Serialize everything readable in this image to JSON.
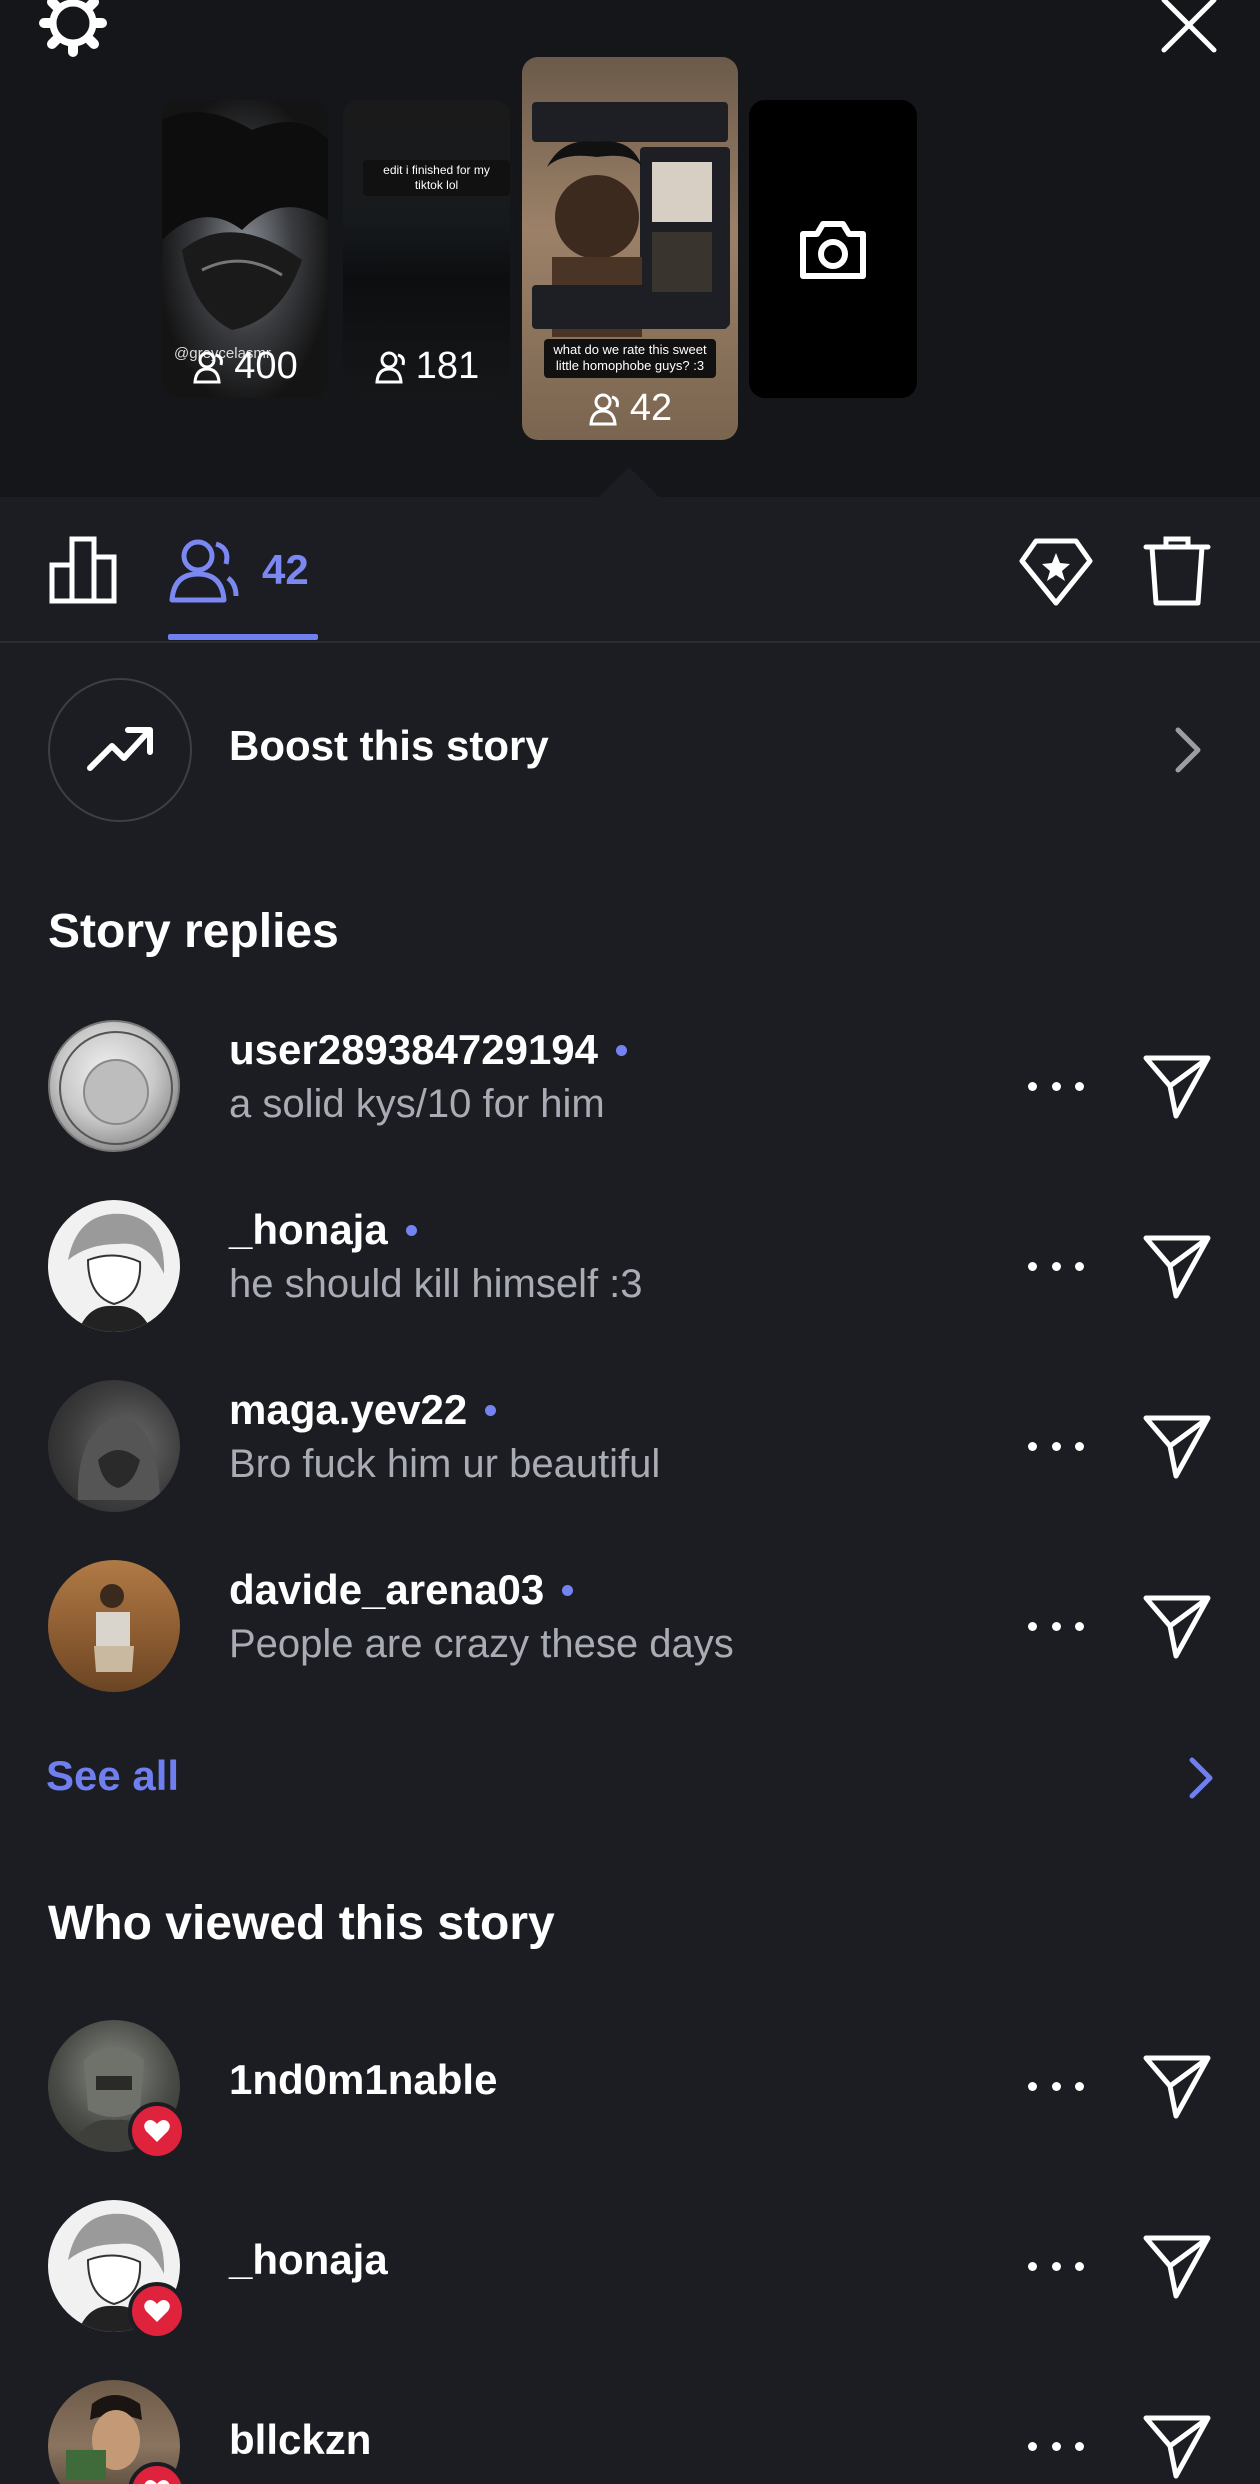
{
  "header": {
    "settings_icon": "gear-icon",
    "close_icon": "close-icon"
  },
  "stories": [
    {
      "views": "400",
      "handle": "@greycelasmr",
      "caption": ""
    },
    {
      "views": "181",
      "handle": "",
      "caption": "edit i finished for my tiktok lol"
    },
    {
      "views": "42",
      "handle": "",
      "caption": "what do we rate this sweet little homophobe guys? :3",
      "selected": true
    },
    {
      "views": "",
      "handle": "",
      "caption": "",
      "icon": "camera-icon"
    }
  ],
  "tabs": {
    "viewers_count": "42",
    "accent": "#6f7ff0"
  },
  "boost": {
    "label": "Boost this story"
  },
  "replies": {
    "title": "Story replies",
    "items": [
      {
        "username": "user289384729194",
        "text": "a solid kys/10 for him"
      },
      {
        "username": "_honaja",
        "text": "he should kill himself :3"
      },
      {
        "username": "maga.yev22",
        "text": "Bro fuck him ur beautiful"
      },
      {
        "username": "davide_arena03",
        "text": "People are crazy these days"
      }
    ],
    "see_all": "See all"
  },
  "viewers": {
    "title": "Who viewed this story",
    "items": [
      {
        "username": "1nd0m1nable"
      },
      {
        "username": "_honaja"
      },
      {
        "username": "bllckzn"
      }
    ]
  }
}
